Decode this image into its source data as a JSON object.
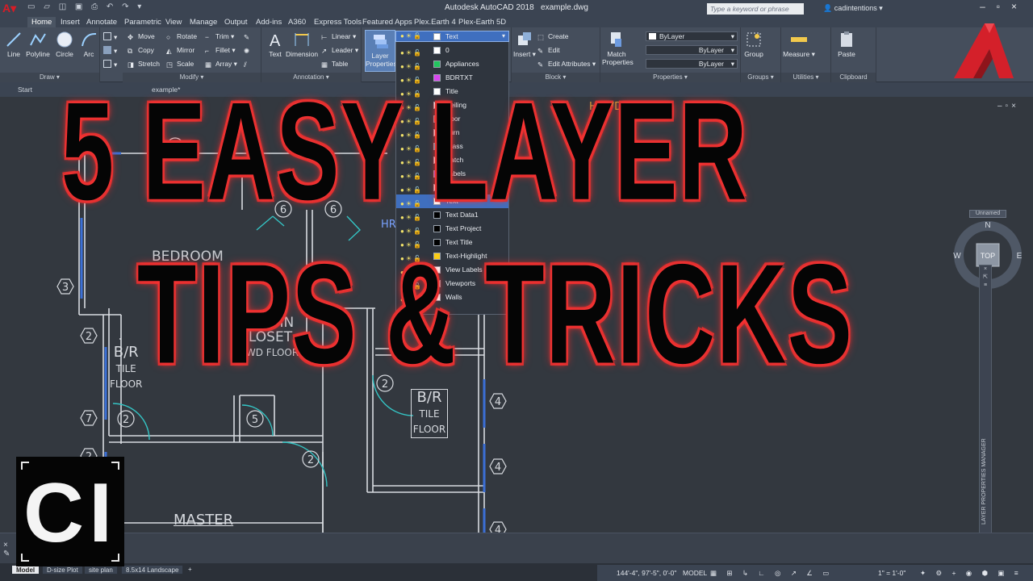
{
  "titlebar": {
    "app_name": "Autodesk AutoCAD 2018",
    "file_name": "example.dwg",
    "search_placeholder": "Type a keyword or phrase",
    "user": "cadintentions"
  },
  "ribbon_tabs": [
    "Home",
    "Insert",
    "Annotate",
    "Parametric",
    "View",
    "Manage",
    "Output",
    "Add-ins",
    "A360",
    "Express Tools",
    "Featured Apps",
    "Plex.Earth 4",
    "Plex-Earth 5D"
  ],
  "draw": {
    "title": "Draw",
    "line": "Line",
    "polyline": "Polyline",
    "circle": "Circle",
    "arc": "Arc"
  },
  "modify": {
    "title": "Modify",
    "move": "Move",
    "rotate": "Rotate",
    "trim": "Trim",
    "copy": "Copy",
    "mirror": "Mirror",
    "fillet": "Fillet",
    "stretch": "Stretch",
    "scale": "Scale",
    "array": "Array"
  },
  "annotation": {
    "title": "Annotation",
    "text": "Text",
    "dimension": "Dimension",
    "linear": "Linear",
    "leader": "Leader",
    "table": "Table"
  },
  "layers": {
    "properties_l1": "Layer",
    "properties_l2": "Properties",
    "current": "Text"
  },
  "block": {
    "title": "Block",
    "insert": "Insert",
    "create": "Create",
    "edit": "Edit",
    "edit_attributes": "Edit Attributes"
  },
  "properties": {
    "title": "Properties",
    "match_l1": "Match",
    "match_l2": "Properties",
    "bylayer1": "ByLayer",
    "bylayer2": "ByLayer",
    "bylayer3": "ByLayer"
  },
  "groups": {
    "title": "Groups",
    "group": "Group"
  },
  "utilities": {
    "title": "Utilities",
    "measure": "Measure"
  },
  "clipboard": {
    "title": "Clipboard",
    "paste": "Paste"
  },
  "file_tabs": {
    "start": "Start",
    "example": "example*"
  },
  "layer_dropdown": [
    {
      "name": "0",
      "color": "#ffffff"
    },
    {
      "name": "Appliances",
      "color": "#22c55e"
    },
    {
      "name": "BDRTXT",
      "color": "#d946ef"
    },
    {
      "name": "Title",
      "color": "#ffffff"
    },
    {
      "name": "Ceiling",
      "color": "#ffffff"
    },
    {
      "name": "Door",
      "color": "#ef4444"
    },
    {
      "name": "Furn",
      "color": "#ffffff"
    },
    {
      "name": "Glass",
      "color": "#22d3ee"
    },
    {
      "name": "Hatch",
      "color": "#ffffff"
    },
    {
      "name": "Labels",
      "color": "#a855f7"
    },
    {
      "name": "To Linework",
      "color": "#ffffff"
    },
    {
      "name": "Text",
      "color": "#ffffff",
      "selected": true
    },
    {
      "name": "Text Data1",
      "color": "#000000"
    },
    {
      "name": "Text Project",
      "color": "#000000"
    },
    {
      "name": "Text Title",
      "color": "#000000"
    },
    {
      "name": "Text-Highlight",
      "color": "#facc15"
    },
    {
      "name": "View Labels",
      "color": "#ffffff"
    },
    {
      "name": "Viewports",
      "color": "#ffffff"
    },
    {
      "name": "Walls",
      "color": "#ffffff"
    }
  ],
  "drawing": {
    "bedroom": "BEDROOM",
    "walkin_l1": "WALK-IN",
    "walkin_l2": "CLOSET",
    "walkin_l3": "HRWD FLOOR",
    "br1": "B/R",
    "br1_floor_l1": "TILE",
    "br1_floor_l2": "FLOOR",
    "br2": "B/R",
    "br2_floor_l1": "TILE",
    "br2_floor_l2": "FLOOR",
    "master": "MASTER",
    "hrwd": "HRWD",
    "hr": "HR",
    "tags": [
      "2",
      "6",
      "6",
      "3",
      "2",
      "2",
      "7",
      "2",
      "5",
      "2",
      "2",
      "4",
      "4",
      "4"
    ]
  },
  "viewcube": {
    "n": "N",
    "s": "S",
    "e": "E",
    "w": "W",
    "top": "TOP",
    "unnamed": "Unnamed"
  },
  "palette_title": "LAYER PROPERTIES MANAGER",
  "layout_tabs": [
    "Model",
    "D-size Plot",
    "site plan",
    "8.5x14 Landscape"
  ],
  "status": {
    "coords": "144'-4\", 97'-5\", 0'-0\"",
    "model": "MODEL",
    "scale": "1\" = 1'-0\""
  },
  "overlay": {
    "line1": "5 EASY LAYER",
    "line2": "TIPS & TRICKS",
    "logo": "CI"
  }
}
